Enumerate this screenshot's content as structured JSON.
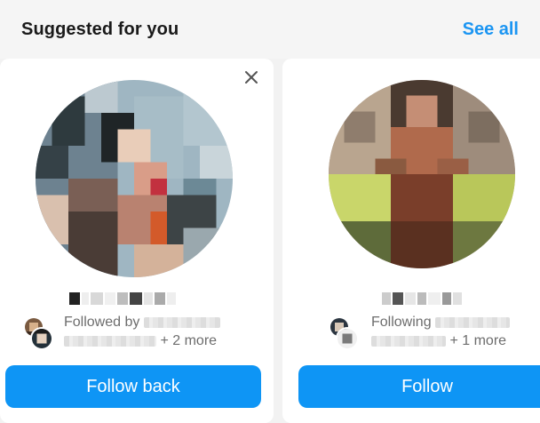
{
  "header": {
    "title": "Suggested for you",
    "see_all": "See all"
  },
  "cards": [
    {
      "followed_prefix": "Followed by",
      "more_text": "+ 2 more",
      "button_label": "Follow back"
    },
    {
      "followed_prefix": "Following",
      "more_text": "+ 1 more",
      "button_label": "Follow"
    }
  ],
  "colors": {
    "accent": "#0e95f5",
    "link": "#1b95f2"
  },
  "icons": {
    "dismiss": "close-icon"
  }
}
